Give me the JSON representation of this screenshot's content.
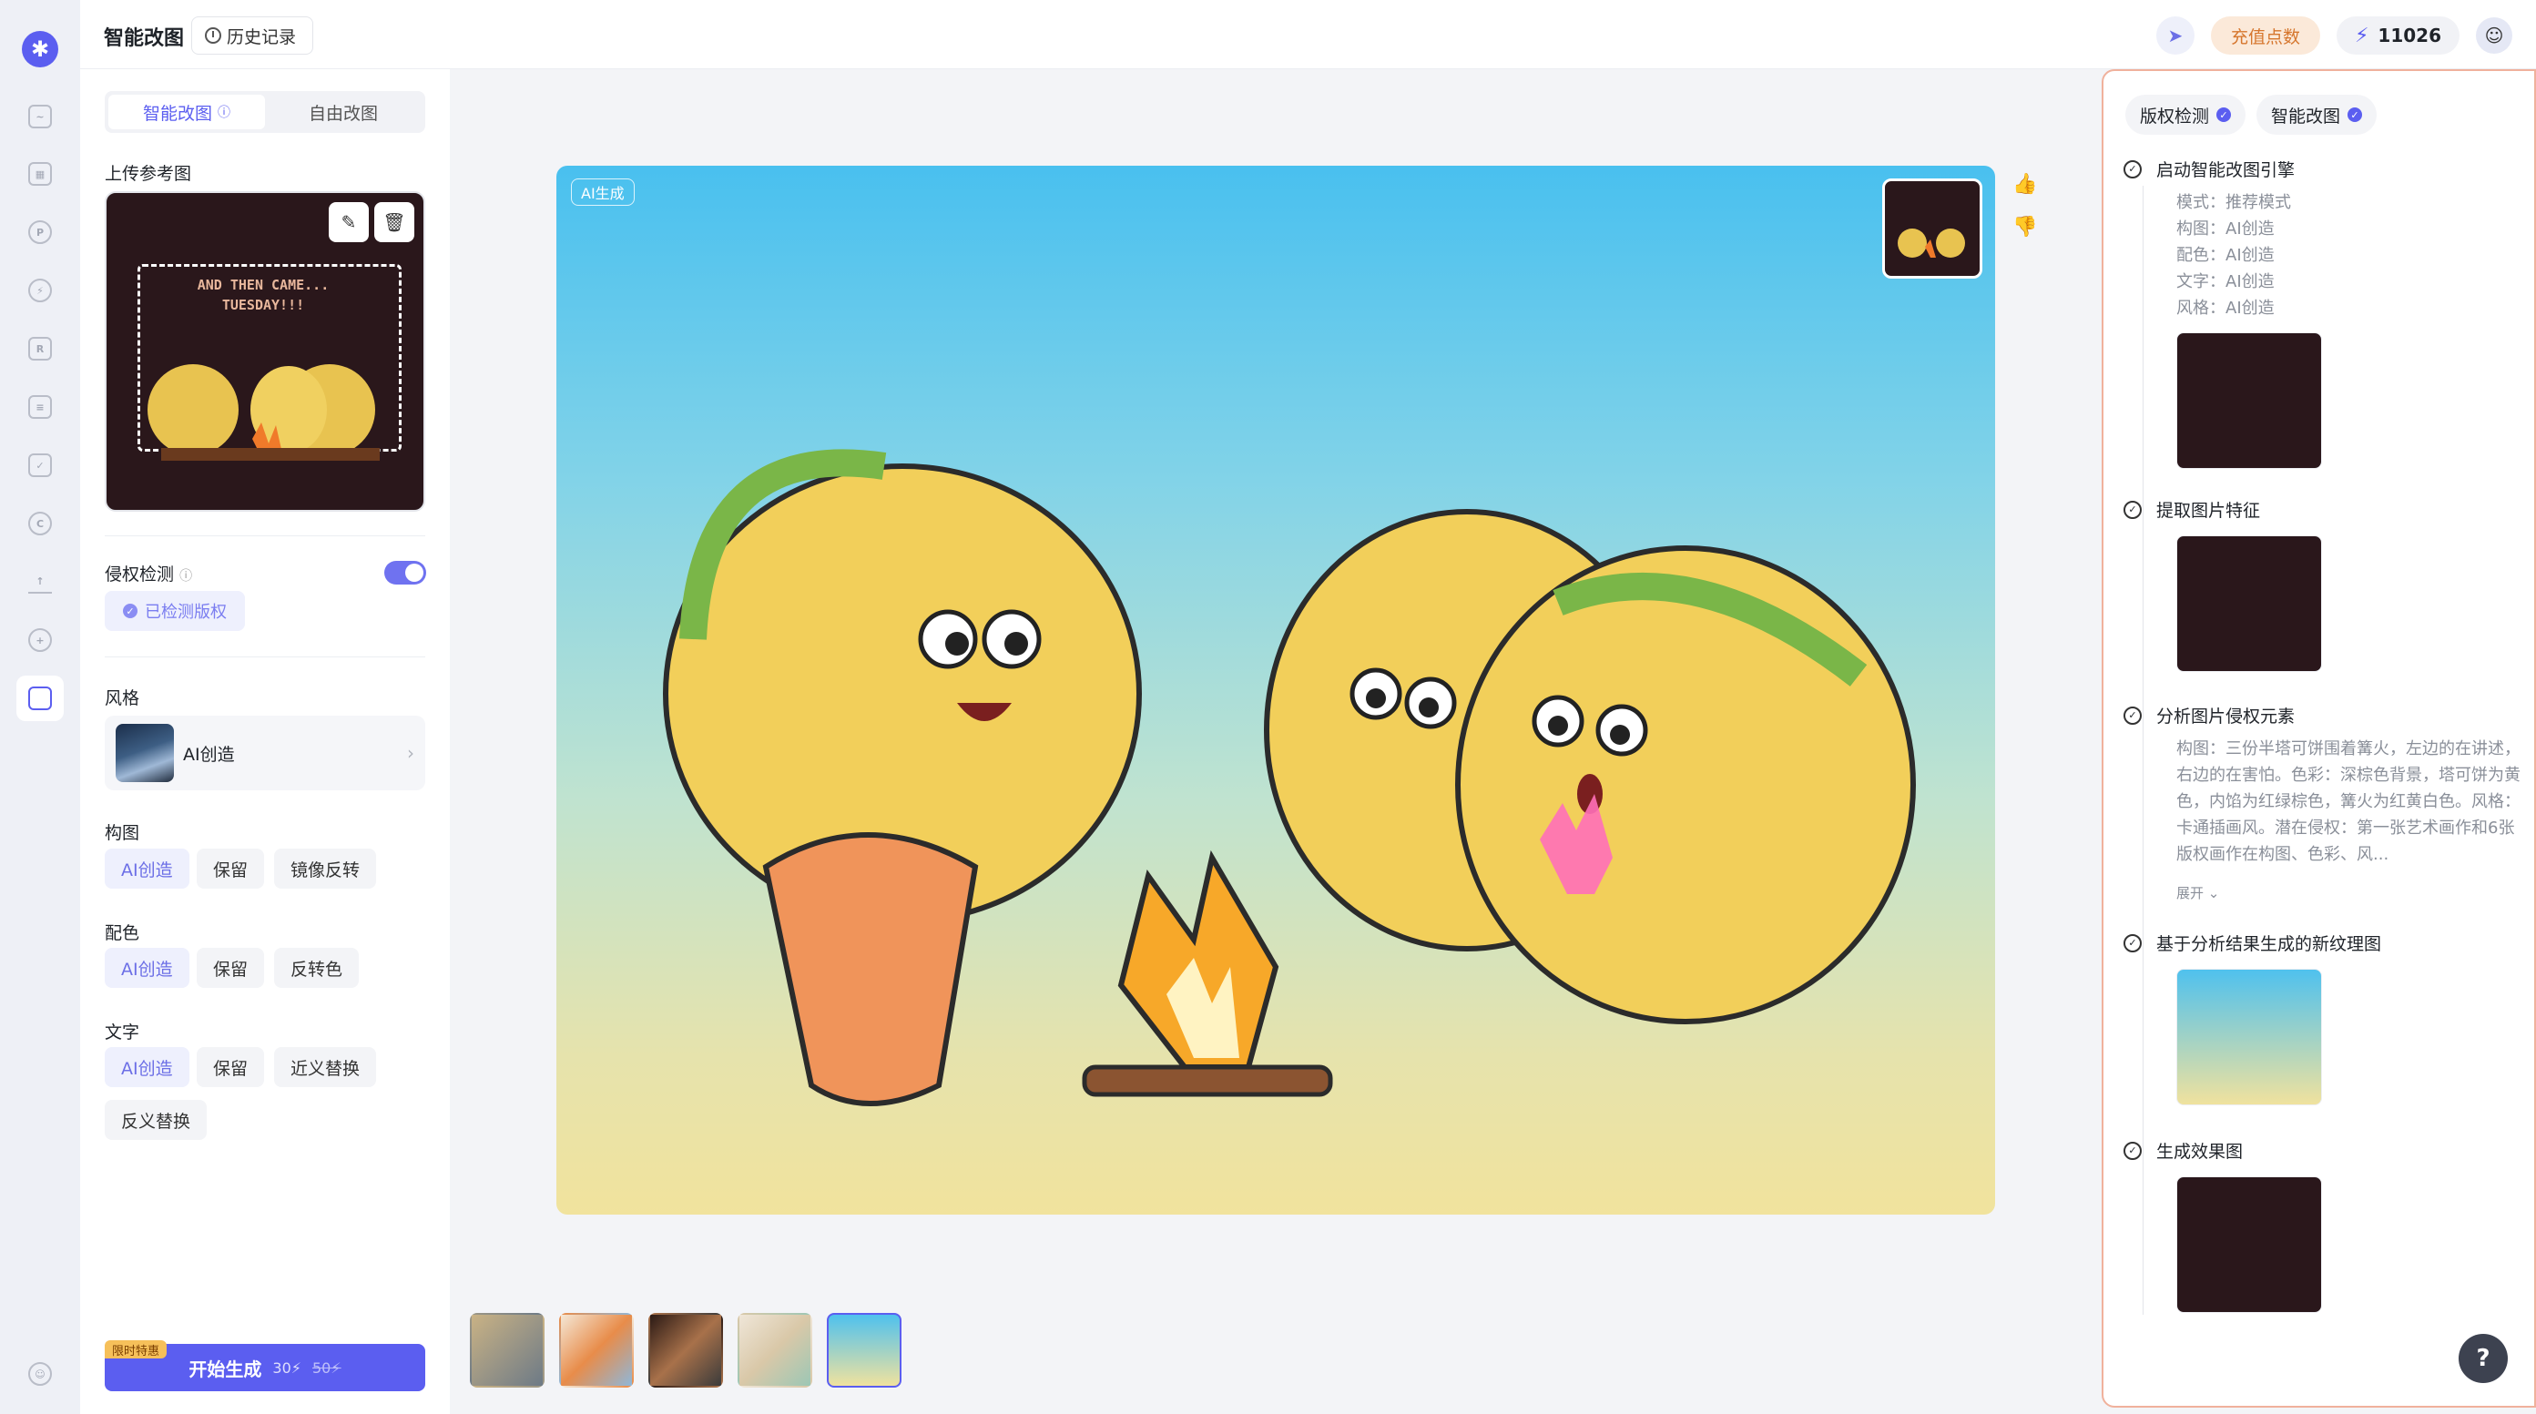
{
  "app": {
    "title": "智能改图",
    "history_label": "历史记录"
  },
  "topbar": {
    "recharge_label": "充值点数",
    "points": "11026"
  },
  "left": {
    "tabs": [
      {
        "label": "智能改图",
        "active": true
      },
      {
        "label": "自由改图",
        "active": false
      }
    ],
    "upload_label": "上传参考图",
    "ref_image_text": "AND THEN CAME... TUESDAY!!!",
    "infringement_label": "侵权检测",
    "infringement_on": true,
    "detected_label": "已检测版权",
    "style_label": "风格",
    "style_value": "AI创造",
    "composition_label": "构图",
    "composition_options": [
      {
        "label": "AI创造",
        "active": true
      },
      {
        "label": "保留",
        "active": false
      },
      {
        "label": "镜像反转",
        "active": false
      }
    ],
    "color_label": "配色",
    "color_options": [
      {
        "label": "AI创造",
        "active": true
      },
      {
        "label": "保留",
        "active": false
      },
      {
        "label": "反转色",
        "active": false
      }
    ],
    "text_label": "文字",
    "text_options": [
      {
        "label": "AI创造",
        "active": true
      },
      {
        "label": "保留",
        "active": false
      },
      {
        "label": "近义替换",
        "active": false
      },
      {
        "label": "反义替换",
        "active": false
      }
    ],
    "promo_badge": "限时特惠",
    "generate_label": "开始生成",
    "cost_current": "30",
    "cost_old": "50"
  },
  "canvas": {
    "badge": "AI生成"
  },
  "right": {
    "tabs": [
      {
        "label": "版权检测"
      },
      {
        "label": "智能改图"
      }
    ],
    "steps": [
      {
        "title": "启动智能改图引擎",
        "details": [
          "模式：推荐模式",
          "构图：AI创造",
          "配色：AI创造",
          "文字：AI创造",
          "风格：AI创造"
        ]
      },
      {
        "title": "提取图片特征"
      },
      {
        "title": "分析图片侵权元素",
        "paragraph": "构图：三份半塔可饼围着篝火，左边的在讲述，右边的在害怕。色彩：深棕色背景，塔可饼为黄色，内馅为红绿棕色，篝火为红黄白色。风格：卡通插画风。潜在侵权：第一张艺术画作和6张版权画作在构图、色彩、风...",
        "expand_label": "展开"
      },
      {
        "title": "基于分析结果生成的新纹理图"
      },
      {
        "title": "生成效果图"
      }
    ]
  },
  "colors": {
    "accent": "#5b5ef0",
    "recharge": "#d6762d",
    "panel_border": "#f0b19c"
  }
}
